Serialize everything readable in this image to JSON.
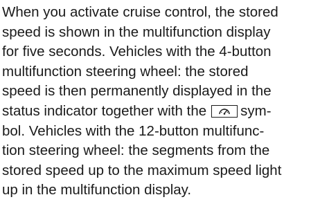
{
  "paragraph": {
    "lines": [
      "When you activate cruise control, the stored",
      "speed is shown in the multifunction display",
      "for five seconds. Vehicles with the 4-button",
      "multifunction steering wheel: the stored",
      "speed is then permanently displayed in the",
      "status indicator together with the",
      "sym-",
      "bol. Vehicles with the 12-button multifunc-",
      "tion steering wheel: the segments from the",
      "stored speed up to the maximum speed light",
      "up in the multifunction display."
    ],
    "symbol_icon": "cruise-control-speedometer-icon"
  }
}
